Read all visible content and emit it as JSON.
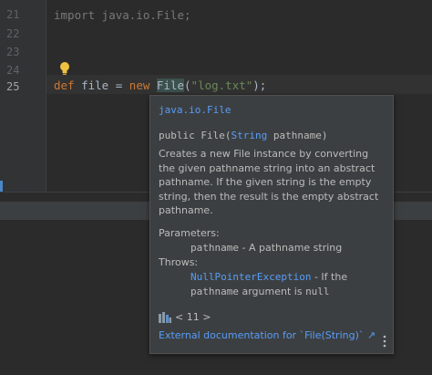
{
  "editor": {
    "line_numbers": [
      "21",
      "22",
      "23",
      "24",
      "25"
    ],
    "current_line": "25",
    "line21": "import java.io.File;",
    "line25": {
      "kw_def": "def",
      "var": " file = ",
      "kw_new": "new",
      "space": " ",
      "cls": "File",
      "open": "(",
      "arg": "\"log.txt\"",
      "close": ");"
    }
  },
  "popup": {
    "header": "java.io.File",
    "sig_prefix": "public File(",
    "sig_type": "String",
    "sig_suffix": " pathname)",
    "description": "Creates a new File instance by converting the given pathname string into an abstract pathname. If the given string is the empty string, then the result is the empty abstract pathname.",
    "params_label": "Parameters:",
    "param_name": "pathname",
    "param_desc": " - A pathname string",
    "throws_label": "Throws:",
    "throw_type": "NullPointerException",
    "throw_desc": " - If the",
    "throw_desc2_pre": "pathname",
    "throw_desc2_mid": " argument is ",
    "throw_desc2_null": "null",
    "jdk_label": "< 11 >",
    "external_link": "External documentation for `File(String)` ↗"
  },
  "colors": {
    "keyword": "#cc7832",
    "string": "#6a8759",
    "link": "#589df6",
    "text": "#bbbbbb"
  },
  "icons": {
    "intention": "lightbulb-icon",
    "library": "jdk-library-icon",
    "menu": "more-vertical-icon"
  }
}
